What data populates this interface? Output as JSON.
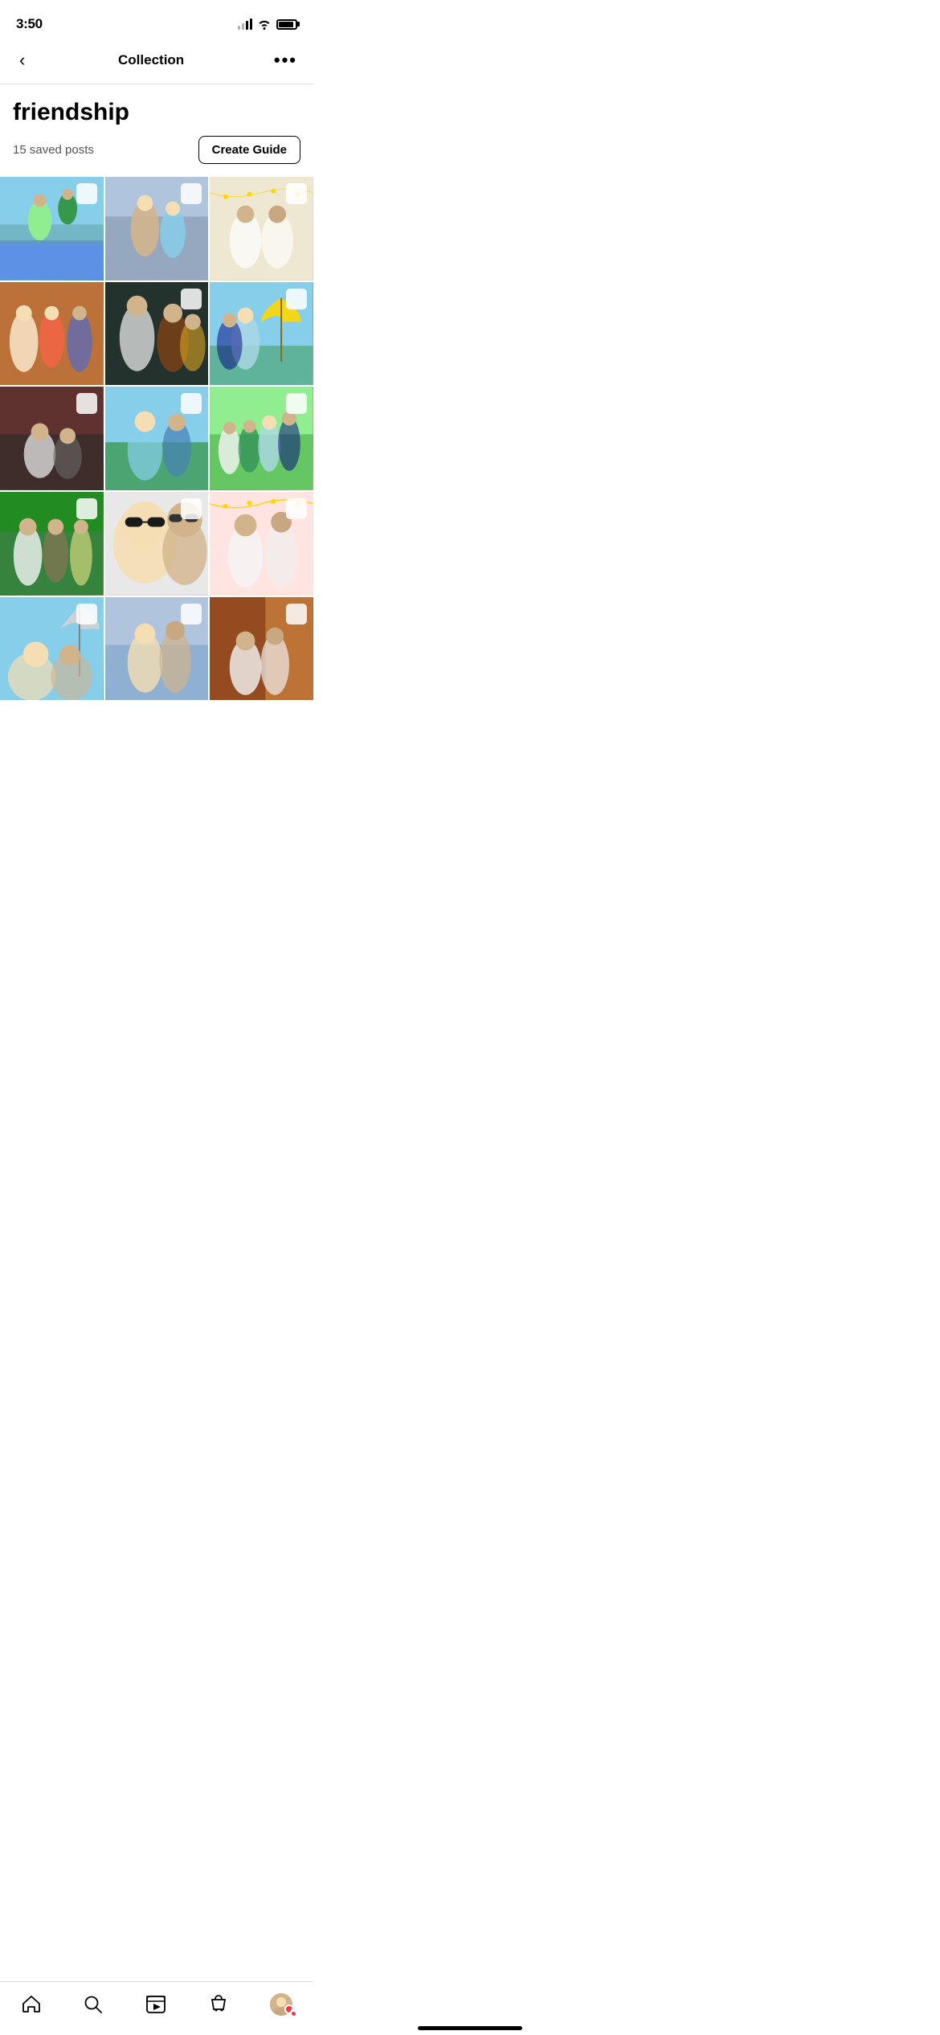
{
  "statusBar": {
    "time": "3:50"
  },
  "header": {
    "backLabel": "‹",
    "title": "Collection",
    "moreLabel": "•••"
  },
  "collection": {
    "name": "friendship",
    "savedCount": "15 saved posts",
    "createGuideLabel": "Create Guide"
  },
  "photos": [
    {
      "id": 1,
      "colorClass": "photo-1",
      "hasCheckbox": true
    },
    {
      "id": 2,
      "colorClass": "photo-2",
      "hasCheckbox": true
    },
    {
      "id": 3,
      "colorClass": "photo-3",
      "hasCheckbox": true
    },
    {
      "id": 4,
      "colorClass": "photo-4",
      "hasCheckbox": false
    },
    {
      "id": 5,
      "colorClass": "photo-5",
      "hasCheckbox": true
    },
    {
      "id": 6,
      "colorClass": "photo-6",
      "hasCheckbox": true
    },
    {
      "id": 7,
      "colorClass": "photo-7",
      "hasCheckbox": true
    },
    {
      "id": 8,
      "colorClass": "photo-8",
      "hasCheckbox": true
    },
    {
      "id": 9,
      "colorClass": "photo-9",
      "hasCheckbox": true
    },
    {
      "id": 10,
      "colorClass": "photo-10",
      "hasCheckbox": true
    },
    {
      "id": 11,
      "colorClass": "photo-11",
      "hasCheckbox": true
    },
    {
      "id": 12,
      "colorClass": "photo-12",
      "hasCheckbox": true
    },
    {
      "id": 13,
      "colorClass": "photo-13",
      "hasCheckbox": true
    },
    {
      "id": 14,
      "colorClass": "photo-14",
      "hasCheckbox": true
    },
    {
      "id": 15,
      "colorClass": "photo-15",
      "hasCheckbox": true
    }
  ],
  "bottomNav": {
    "items": [
      {
        "id": "home",
        "label": "home"
      },
      {
        "id": "search",
        "label": "search"
      },
      {
        "id": "reels",
        "label": "reels"
      },
      {
        "id": "shop",
        "label": "shop"
      },
      {
        "id": "profile",
        "label": "profile"
      }
    ]
  }
}
